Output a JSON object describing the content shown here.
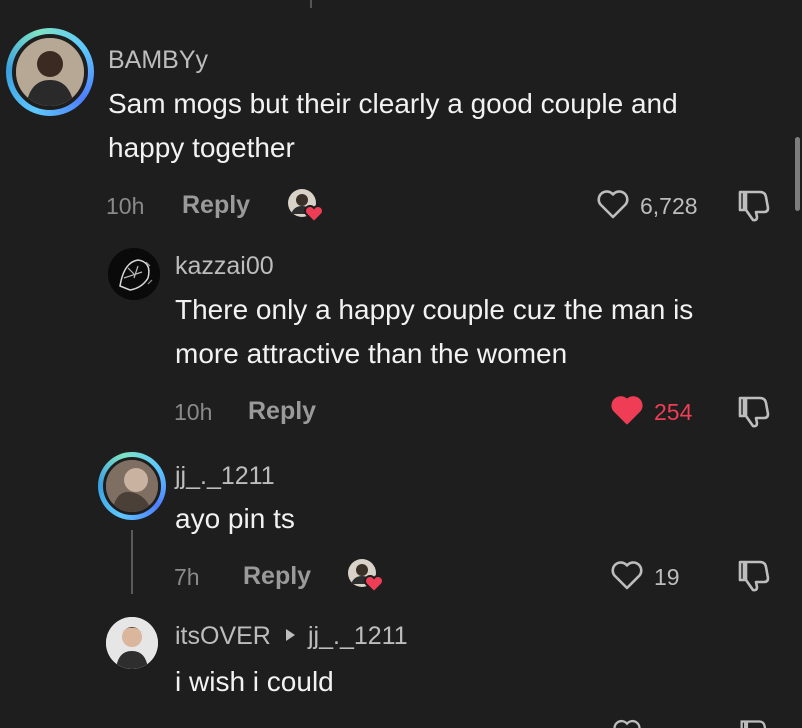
{
  "comments": [
    {
      "username": "BAMBYy",
      "text_line1": "Sam mogs but their clearly a good couple and",
      "text_line2": "happy together",
      "time": "10h",
      "reply_label": "Reply",
      "likes": "6,728",
      "liked": false
    },
    {
      "username": "kazzai00",
      "text_line1": "There only a happy couple cuz the man is",
      "text_line2": "more attractive than the women",
      "time": "10h",
      "reply_label": "Reply",
      "likes": "254",
      "liked": true
    },
    {
      "username": "jj_._1211",
      "text_line1": "ayo pin ts",
      "time": "7h",
      "reply_label": "Reply",
      "likes": "19",
      "liked": false
    },
    {
      "username": "itsOVER",
      "reply_to": "jj_._1211",
      "text_line1": "i wish i could"
    }
  ],
  "colors": {
    "background": "#1e1e1e",
    "like_red": "#ee3d55",
    "ring_blue": "#5ec7ff"
  }
}
